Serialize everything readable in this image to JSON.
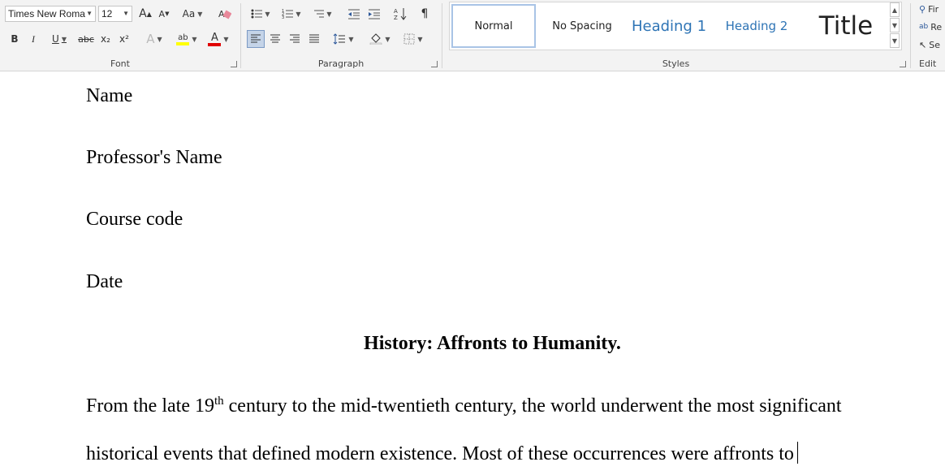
{
  "font_group": {
    "font_name": "Times New Roma",
    "font_size": "12",
    "grow_label": "A",
    "shrink_label": "A",
    "case_label": "Aa",
    "bold": "B",
    "italic": "I",
    "underline": "U",
    "strike": "abc",
    "subscript": "x₂",
    "superscript": "x²",
    "effects": "A",
    "highlight": "ab",
    "font_color": "A",
    "label": "Font",
    "highlight_color": "#ffff00",
    "font_color_value": "#e00000"
  },
  "paragraph_group": {
    "label": "Paragraph"
  },
  "styles_group": {
    "label": "Styles",
    "items": [
      "Normal",
      "No Spacing",
      "Heading 1",
      "Heading 2",
      "Title"
    ],
    "heading_color": "#2e74b5"
  },
  "editing_group": {
    "label": "Edit",
    "find": "Fir",
    "replace": "Re",
    "select": "Se"
  },
  "document": {
    "line1": "Name",
    "line2": "Professor's Name",
    "line3": "Course code",
    "line4": "Date",
    "title": "History: Affronts to Humanity.",
    "para1_a": "From the late 19",
    "para1_sup": "th",
    "para1_b": " century to the mid-twentieth century, the world underwent the most significant",
    "para2": "historical events that defined modern existence. Most of these occurrences were affronts to"
  }
}
